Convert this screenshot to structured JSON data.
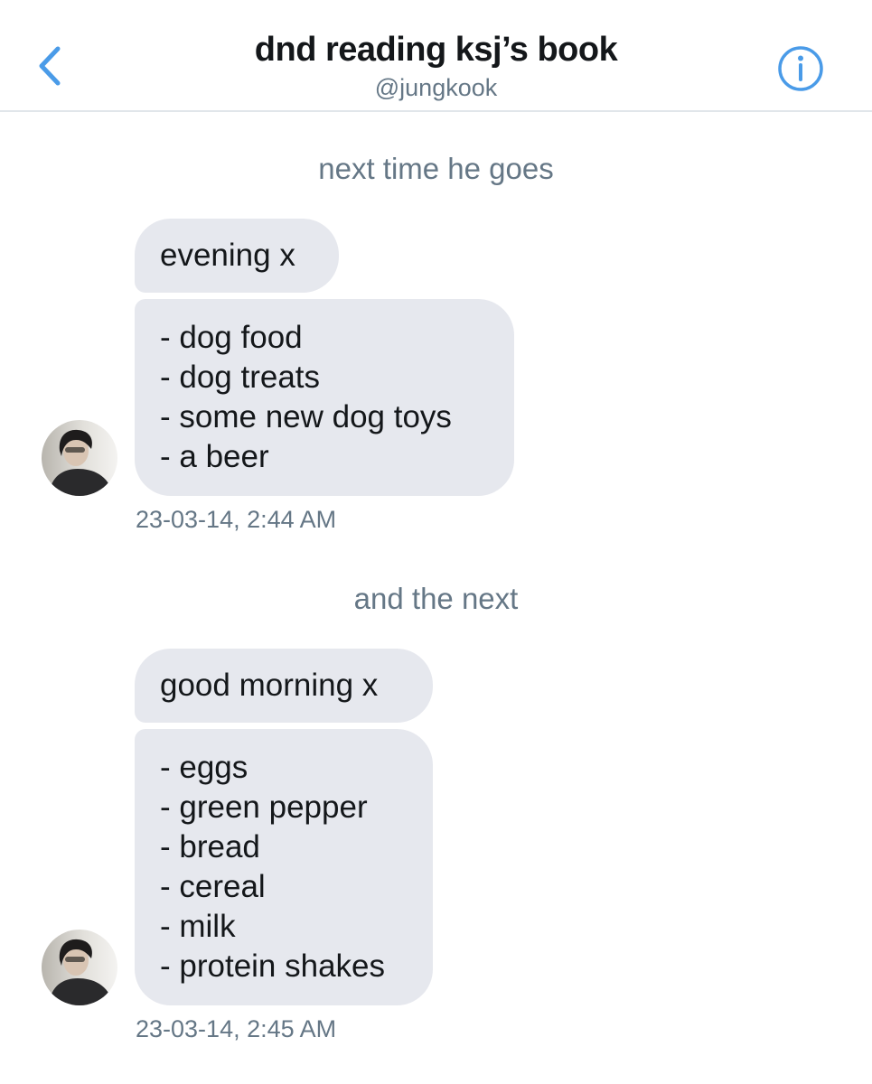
{
  "header": {
    "title": "dnd reading ksj’s book",
    "handle": "@jungkook",
    "back_icon": "chevron-left-icon",
    "info_icon": "info-circle-icon",
    "accent_color": "#4a9be8"
  },
  "groups": [
    {
      "note": "next time he goes",
      "first_bubble": "evening x",
      "list_lines": [
        "- dog food",
        "- dog treats",
        "- some new dog toys",
        "- a beer"
      ],
      "timestamp": "23-03-14, 2:44 AM"
    },
    {
      "note": "and the next",
      "first_bubble": "good morning x",
      "list_lines": [
        "- eggs",
        "- green pepper",
        "- bread",
        "- cereal",
        "- milk",
        "- protein shakes"
      ],
      "timestamp": "23-03-14, 2:45 AM"
    }
  ],
  "colors": {
    "bubble_bg": "#e6e8ee",
    "text": "#14171a",
    "meta_text": "#657786"
  }
}
